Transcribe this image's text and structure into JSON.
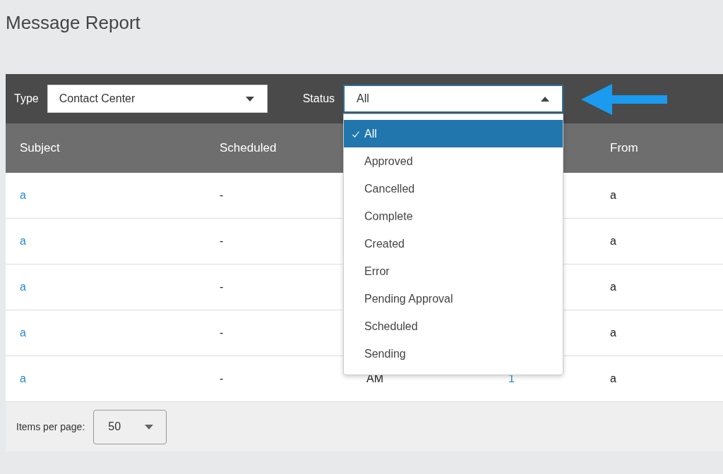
{
  "page": {
    "title": "Message Report"
  },
  "filters": [
    {
      "label": "Type",
      "value": "Contact Center",
      "expanded": false
    },
    {
      "label": "Status",
      "value": "All",
      "expanded": true,
      "options": [
        {
          "label": "All",
          "selected": true
        },
        {
          "label": "Approved",
          "selected": false
        },
        {
          "label": "Cancelled",
          "selected": false
        },
        {
          "label": "Complete",
          "selected": false
        },
        {
          "label": "Created",
          "selected": false
        },
        {
          "label": "Error",
          "selected": false
        },
        {
          "label": "Pending Approval",
          "selected": false
        },
        {
          "label": "Scheduled",
          "selected": false
        },
        {
          "label": "Sending",
          "selected": false
        }
      ]
    }
  ],
  "table": {
    "columns": {
      "subject": "Subject",
      "scheduled": "Scheduled",
      "from": "From"
    },
    "rows": [
      {
        "subject": "a",
        "scheduled": "-",
        "from": "a"
      },
      {
        "subject": "a",
        "scheduled": "-",
        "from": "a"
      },
      {
        "subject": "a",
        "scheduled": "-",
        "from": "a"
      },
      {
        "subject": "a",
        "scheduled": "-",
        "from": "a"
      },
      {
        "subject": "a",
        "scheduled": "-",
        "column_3": "AM",
        "column_4": "1",
        "from": "a"
      }
    ]
  },
  "pagination": {
    "label": "Items per page:",
    "value": "50"
  }
}
